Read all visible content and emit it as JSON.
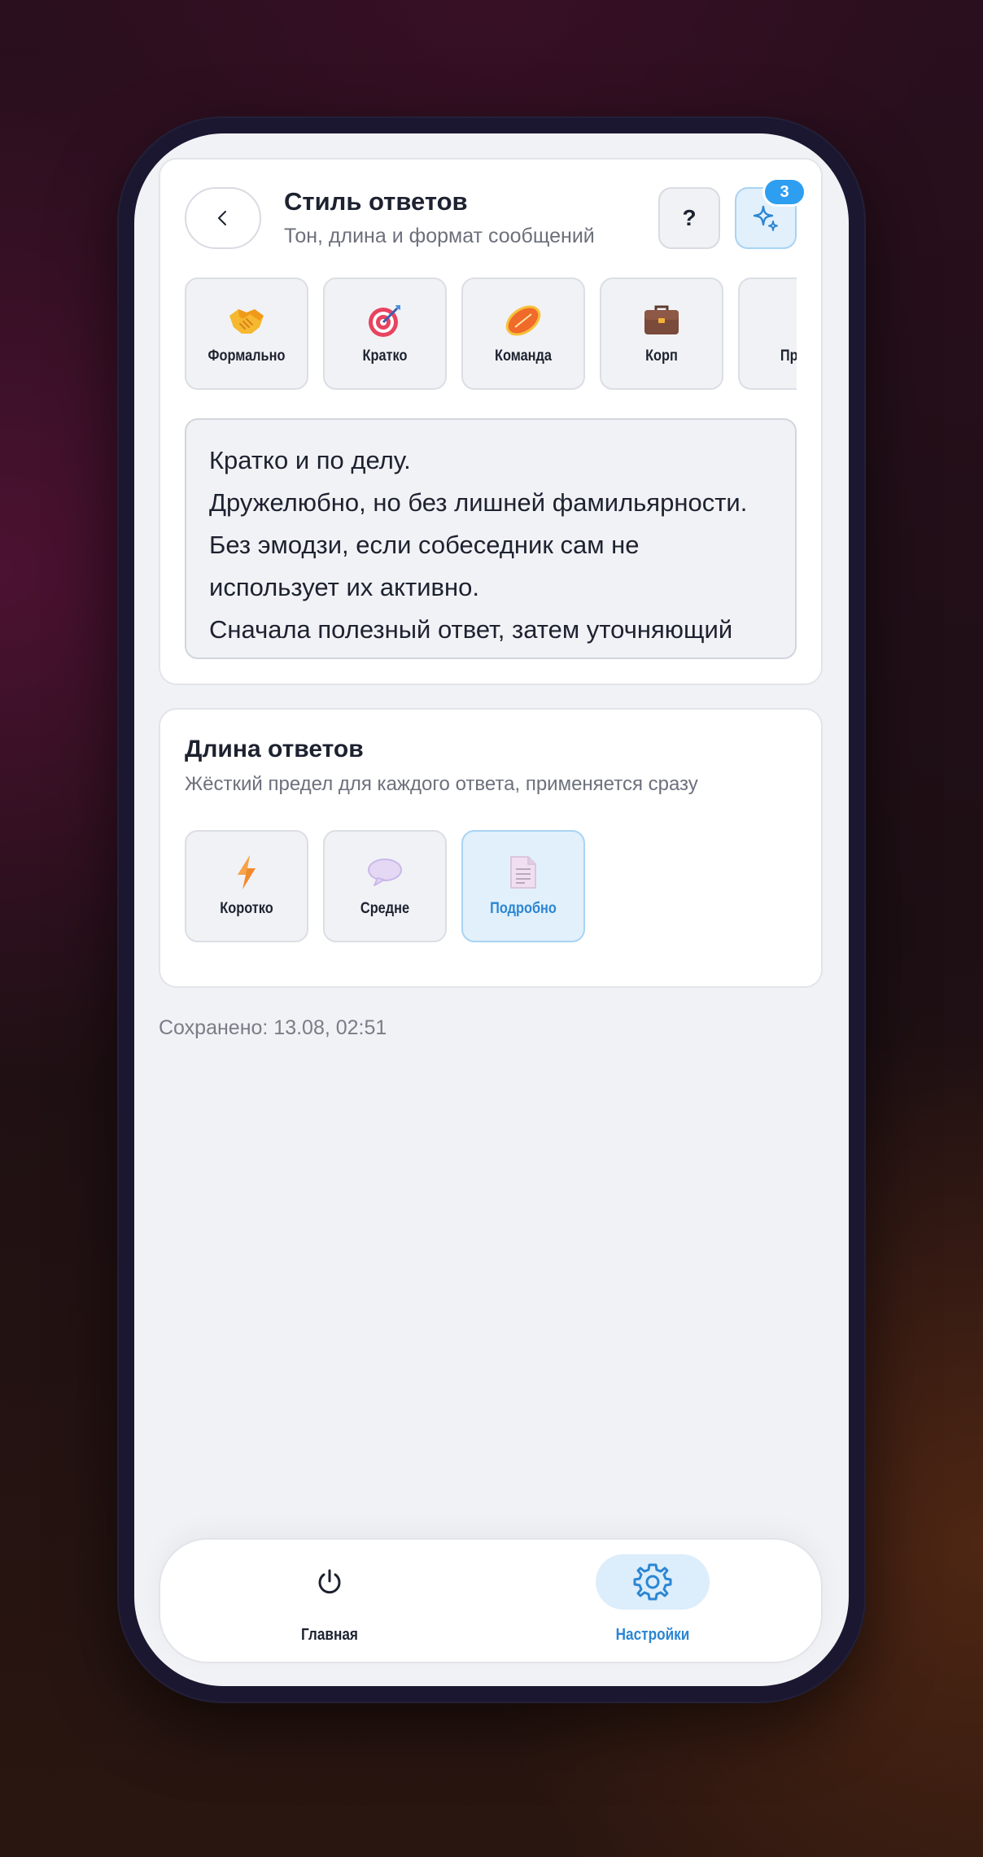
{
  "header": {
    "title": "Стиль ответов",
    "subtitle": "Тон, длина и формат сообщений",
    "help_label": "?",
    "sparkle_badge": "3"
  },
  "presets": [
    {
      "label": "Формально",
      "icon": "handshake-icon"
    },
    {
      "label": "Кратко",
      "icon": "target-icon"
    },
    {
      "label": "Команда",
      "icon": "rugby-ball-icon"
    },
    {
      "label": "Корп",
      "icon": "briefcase-icon"
    },
    {
      "label": "Пр",
      "icon": "partial-icon"
    }
  ],
  "style_text": {
    "lines": [
      "Кратко и по делу.",
      "Дружелюбно, но без лишней фамильярности.",
      "Без эмодзи, если собеседник сам не",
      "использует их активно.",
      "Сначала полезный ответ, затем уточняющий"
    ]
  },
  "length": {
    "title": "Длина ответов",
    "subtitle": "Жёсткий предел для каждого ответа, применяется сразу",
    "options": [
      {
        "label": "Коротко",
        "icon": "lightning-icon",
        "selected": false
      },
      {
        "label": "Средне",
        "icon": "speech-bubble-icon",
        "selected": false
      },
      {
        "label": "Подробно",
        "icon": "document-icon",
        "selected": true
      }
    ]
  },
  "status": {
    "saved_text": "Сохранено: 13.08, 02:51"
  },
  "nav": {
    "home_label": "Главная",
    "settings_label": "Настройки",
    "active": "settings"
  },
  "colors": {
    "accent": "#2b86d3",
    "accent_bg": "#e2f0fb",
    "badge": "#2e9ef0"
  }
}
